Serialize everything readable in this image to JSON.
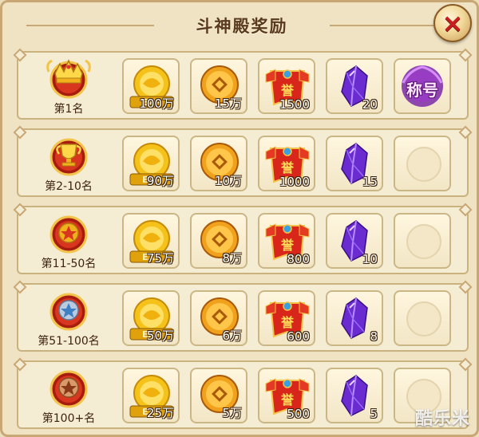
{
  "dialog": {
    "title": "斗神殿奖励",
    "close_label": "×"
  },
  "rewards": [
    {
      "rank": "第1名",
      "medal": "crown-medal-icon",
      "exp": "100万",
      "coins": "15万",
      "honor": "1500",
      "crystal": "20",
      "title_reward": "称号"
    },
    {
      "rank": "第2-10名",
      "medal": "trophy-medal-icon",
      "exp": "90万",
      "coins": "10万",
      "honor": "1000",
      "crystal": "15"
    },
    {
      "rank": "第11-50名",
      "medal": "gold-star-medal-icon",
      "exp": "75万",
      "coins": "8万",
      "honor": "800",
      "crystal": "10"
    },
    {
      "rank": "第51-100名",
      "medal": "silver-star-medal-icon",
      "exp": "50万",
      "coins": "6万",
      "honor": "600",
      "crystal": "8"
    },
    {
      "rank": "第100+名",
      "medal": "bronze-star-medal-icon",
      "exp": "25万",
      "coins": "5万",
      "honor": "500",
      "crystal": "5"
    }
  ],
  "watermark": "酷乐米",
  "colors": {
    "panel_bg": "#efe3c4",
    "row_bg": "#f5ecd4",
    "border": "#c9b27e",
    "close_x": "#c81e1e",
    "crystal": "#6a2bd0",
    "gold": "#f5c21a"
  }
}
